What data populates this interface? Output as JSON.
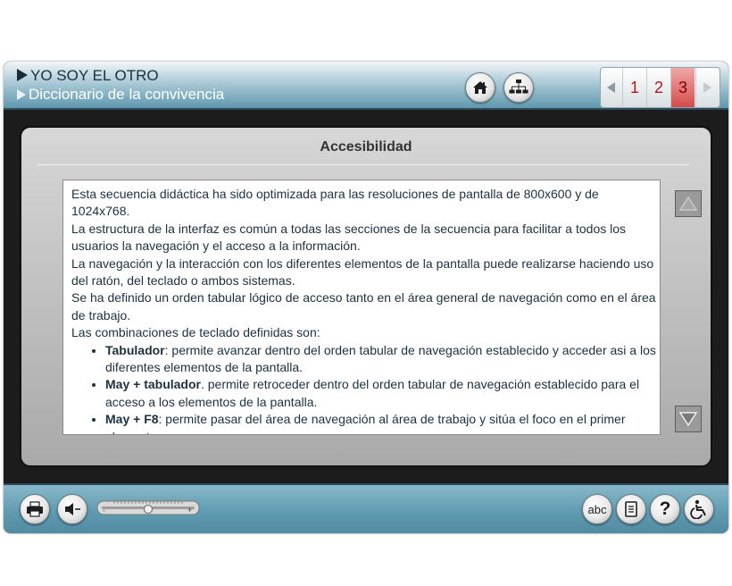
{
  "header": {
    "title": "YO SOY EL OTRO",
    "subtitle": "Diccionario de la convivencia",
    "home_icon": "home-icon",
    "map_icon": "sitemap-icon"
  },
  "pager": {
    "prev_icon": "arrow-left-icon",
    "next_icon": "arrow-right-icon",
    "pages": [
      "1",
      "2",
      "3"
    ],
    "current_page": "3"
  },
  "panel": {
    "title": "Accesibilidad",
    "paragraphs": [
      "Esta secuencia didáctica ha sido optimizada para las resoluciones de pantalla de 800x600 y de 1024x768.",
      "La estructura de la interfaz es común a todas las secciones de la secuencia para facilitar a todos los usuarios la navegación y el acceso a la información.",
      "La navegación  y  la interacción con los diferentes elementos de la pantalla puede realizarse haciendo uso del ratón, del teclado o ambos sistemas.",
      "Se ha definido un orden tabular lógico de acceso tanto en el área general de navegación como en el área de trabajo.",
      "Las combinaciones de teclado definidas son:"
    ],
    "bullets": [
      {
        "key": "Tabulador",
        "text": ": permite avanzar dentro del orden tabular de navegación establecido y acceder asi a los diferentes elementos de la pantalla."
      },
      {
        "key": "May + tabulador",
        "text": ". permite retroceder dentro del orden tabular de navegación establecido para el acceso a los elementos de la pantalla."
      },
      {
        "key": "May + F8",
        "text": ": permite pasar del área de navegación al área de trabajo y sitúa el foco en el primer elemento."
      }
    ],
    "scroll_up_icon": "scroll-up-icon",
    "scroll_down_icon": "scroll-down-icon"
  },
  "footer": {
    "left_icons": [
      "print-icon",
      "audio-icon"
    ],
    "volume_level": 0.5,
    "volume_minus": "-",
    "volume_plus": "+",
    "abc_label": "abc",
    "right_icons": [
      "glossary-icon",
      "document-icon",
      "help-icon",
      "accessibility-icon"
    ],
    "help_label": "?"
  },
  "colors": {
    "header_accent": "#5f98ae",
    "footer_accent": "#5f9ab0",
    "pager_number": "#b3191e",
    "pager_active_bg": "#d74b4b"
  }
}
